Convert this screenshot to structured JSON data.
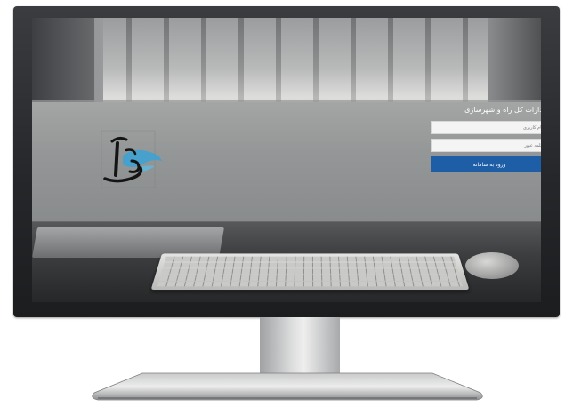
{
  "login": {
    "title": "ادارات کل راه و شهرسازی",
    "username_placeholder": "نام کاربری",
    "password_placeholder": "کلمه عبور",
    "submit_label": "ورود به سامانه"
  },
  "logo": {
    "text": "آکو"
  },
  "colors": {
    "submit_button": "#1d5ea6",
    "logo_accent": "#3aa3d6",
    "band_overlay": "#96989a"
  }
}
